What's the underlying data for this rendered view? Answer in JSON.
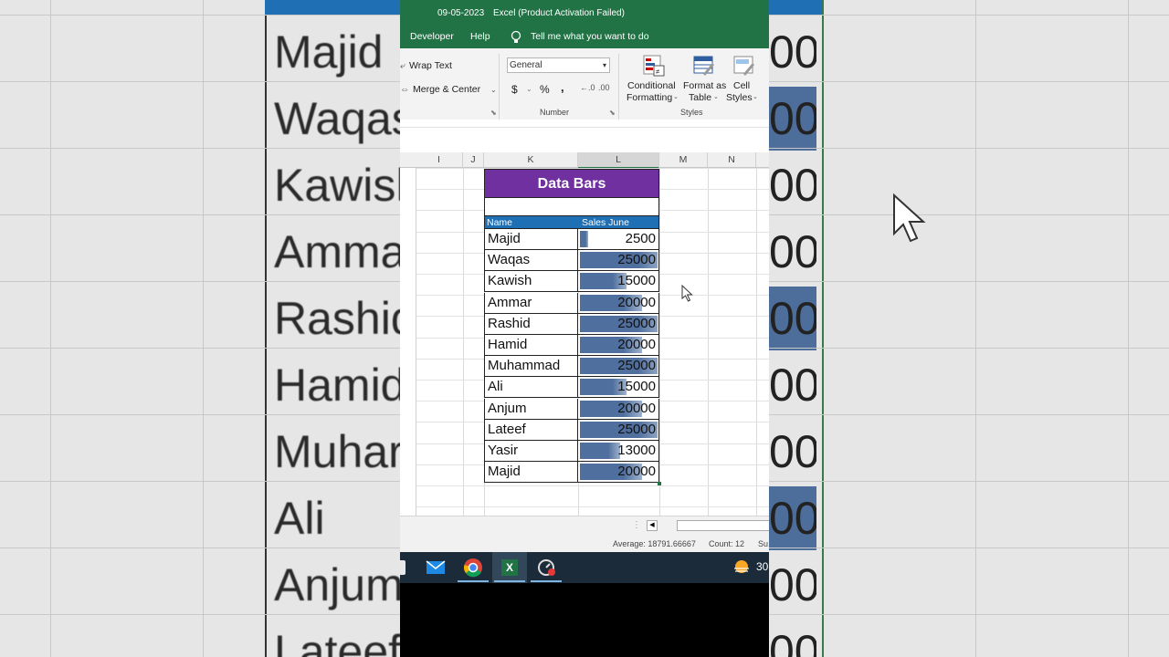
{
  "background": {
    "names": [
      "Majid",
      "Waqas",
      "Kawish",
      "Amma",
      "Rashid",
      "Hamid",
      "Muhar",
      "Ali",
      "Anjum",
      "Lateef"
    ],
    "nums": [
      "00",
      "00",
      "00",
      "00",
      "00",
      "00",
      "00",
      "00",
      "00",
      "00"
    ]
  },
  "title": {
    "date": "09-05-2023",
    "app": "Excel (Product Activation Failed)"
  },
  "menu": {
    "developer": "Developer",
    "help": "Help",
    "tell_me": "Tell me what you want to do"
  },
  "ribbon": {
    "wrap_text": "Wrap Text",
    "merge_center": "Merge & Center",
    "number_format": "General",
    "currency": "$",
    "percent": "%",
    "comma": ",",
    "number_group": "Number",
    "conditional_1": "Conditional",
    "conditional_2": "Formatting",
    "format_table_1": "Format as",
    "format_table_2": "Table",
    "cell_styles_1": "Cell",
    "cell_styles_2": "Styles",
    "styles_group": "Styles"
  },
  "columns": [
    "I",
    "J",
    "K",
    "L",
    "M",
    "N"
  ],
  "table": {
    "title": "Data Bars",
    "header_name": "Name",
    "header_sales": "Sales June",
    "bar_color": "#4f6f9e",
    "header_color": "#1f6fb5",
    "title_color": "#7030a0",
    "rows": [
      {
        "name": "Majid",
        "sales": "2500",
        "fraction": 0.1
      },
      {
        "name": "Waqas",
        "sales": "25000",
        "fraction": 1.0
      },
      {
        "name": "Kawish",
        "sales": "15000",
        "fraction": 0.6
      },
      {
        "name": "Ammar",
        "sales": "20000",
        "fraction": 0.8
      },
      {
        "name": "Rashid",
        "sales": "25000",
        "fraction": 1.0
      },
      {
        "name": "Hamid",
        "sales": "20000",
        "fraction": 0.8
      },
      {
        "name": "Muhammad",
        "sales": "25000",
        "fraction": 1.0
      },
      {
        "name": "Ali",
        "sales": "15000",
        "fraction": 0.6
      },
      {
        "name": "Anjum",
        "sales": "20000",
        "fraction": 0.8
      },
      {
        "name": "Lateef",
        "sales": "25000",
        "fraction": 1.0
      },
      {
        "name": "Yasir",
        "sales": "13000",
        "fraction": 0.52
      },
      {
        "name": "Majid",
        "sales": "20000",
        "fraction": 0.8
      }
    ]
  },
  "status": {
    "average": "Average: 18791.66667",
    "count": "Count: 12",
    "sum": "Su"
  },
  "taskbar": {
    "weather_temp": "30"
  }
}
